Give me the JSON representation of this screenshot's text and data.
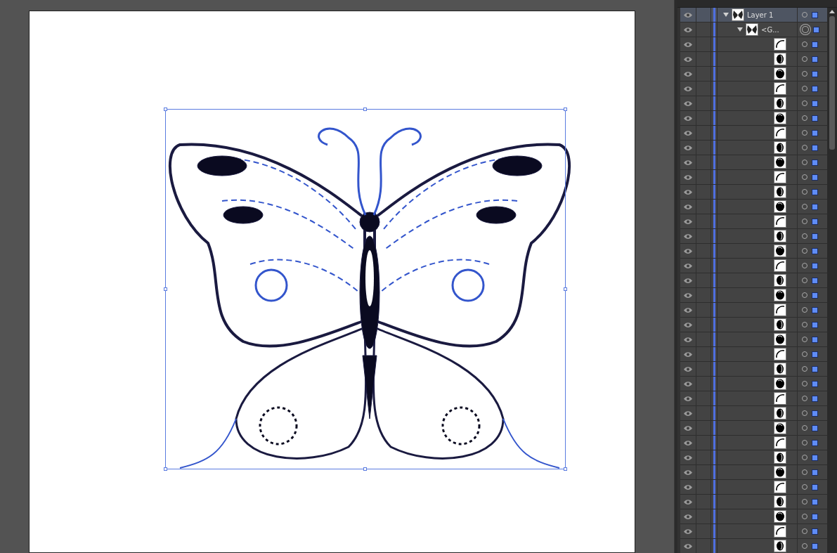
{
  "layers_panel": {
    "items": [
      {
        "kind": "layer",
        "label": "Layer 1",
        "visible": true,
        "expanded": true,
        "selected": true,
        "targeted": false,
        "children": [
          {
            "kind": "group",
            "label": "<G...",
            "visible": true,
            "expanded": true,
            "selected": false,
            "targeted": true,
            "children": [
              {
                "kind": "path",
                "visible": true,
                "selected": false,
                "targeted": false
              },
              {
                "kind": "path",
                "visible": true,
                "selected": false,
                "targeted": false
              },
              {
                "kind": "path",
                "visible": true,
                "selected": false,
                "targeted": false
              },
              {
                "kind": "path",
                "visible": true,
                "selected": false,
                "targeted": false
              },
              {
                "kind": "path",
                "visible": true,
                "selected": false,
                "targeted": false
              },
              {
                "kind": "path",
                "visible": true,
                "selected": false,
                "targeted": false
              },
              {
                "kind": "path",
                "visible": true,
                "selected": false,
                "targeted": false
              },
              {
                "kind": "path",
                "visible": true,
                "selected": false,
                "targeted": false
              },
              {
                "kind": "path",
                "visible": true,
                "selected": false,
                "targeted": false
              },
              {
                "kind": "path",
                "visible": true,
                "selected": false,
                "targeted": false
              },
              {
                "kind": "path",
                "visible": true,
                "selected": false,
                "targeted": false
              },
              {
                "kind": "path",
                "visible": true,
                "selected": false,
                "targeted": false
              },
              {
                "kind": "path",
                "visible": true,
                "selected": false,
                "targeted": false
              },
              {
                "kind": "path",
                "visible": true,
                "selected": false,
                "targeted": false
              },
              {
                "kind": "path",
                "visible": true,
                "selected": false,
                "targeted": false
              },
              {
                "kind": "path",
                "visible": true,
                "selected": false,
                "targeted": false
              },
              {
                "kind": "path",
                "visible": true,
                "selected": false,
                "targeted": false
              },
              {
                "kind": "path",
                "visible": true,
                "selected": false,
                "targeted": false
              },
              {
                "kind": "path",
                "visible": true,
                "selected": false,
                "targeted": false
              },
              {
                "kind": "path",
                "visible": true,
                "selected": false,
                "targeted": false
              },
              {
                "kind": "path",
                "visible": true,
                "selected": false,
                "targeted": false
              },
              {
                "kind": "path",
                "visible": true,
                "selected": false,
                "targeted": false
              },
              {
                "kind": "path",
                "visible": true,
                "selected": false,
                "targeted": false
              },
              {
                "kind": "path",
                "visible": true,
                "selected": false,
                "targeted": false
              },
              {
                "kind": "path",
                "visible": true,
                "selected": false,
                "targeted": false
              },
              {
                "kind": "path",
                "visible": true,
                "selected": false,
                "targeted": false
              },
              {
                "kind": "path",
                "visible": true,
                "selected": false,
                "targeted": false
              },
              {
                "kind": "path",
                "visible": true,
                "selected": false,
                "targeted": false
              },
              {
                "kind": "path",
                "visible": true,
                "selected": false,
                "targeted": false
              },
              {
                "kind": "path",
                "visible": true,
                "selected": false,
                "targeted": false
              },
              {
                "kind": "path",
                "visible": true,
                "selected": false,
                "targeted": false
              },
              {
                "kind": "path",
                "visible": true,
                "selected": false,
                "targeted": false
              },
              {
                "kind": "path",
                "visible": true,
                "selected": false,
                "targeted": false
              },
              {
                "kind": "path",
                "visible": true,
                "selected": false,
                "targeted": false
              },
              {
                "kind": "path",
                "visible": true,
                "selected": false,
                "targeted": false
              }
            ]
          }
        ]
      }
    ]
  }
}
